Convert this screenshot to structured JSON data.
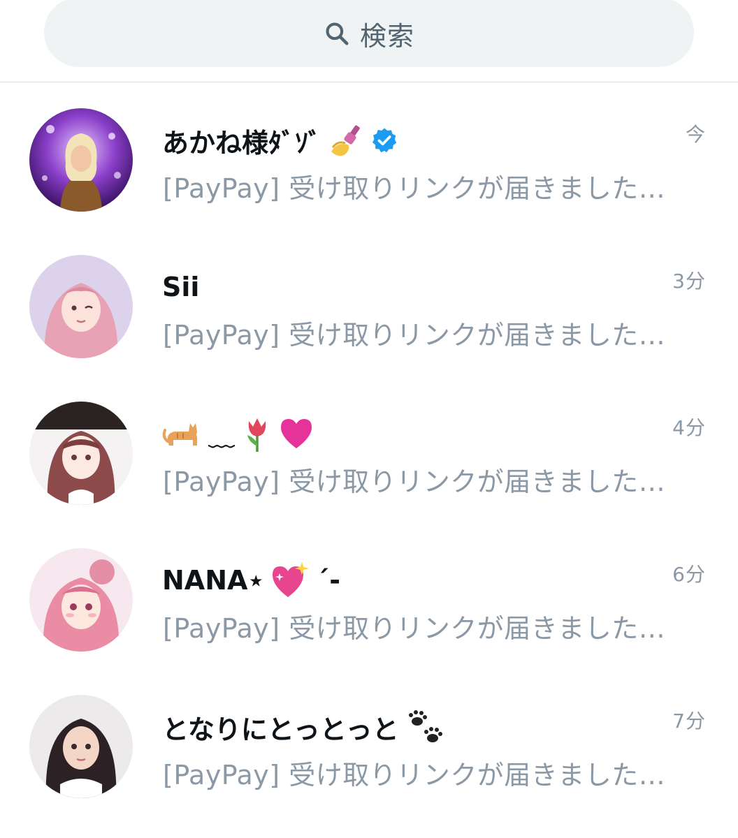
{
  "search": {
    "label": "検索",
    "icon": "search-icon"
  },
  "conversations": [
    {
      "name": "あかね様ﾀﾞｿﾞ",
      "time": "今",
      "preview": "[PayPay] 受け取りリンクが届きました…",
      "icons": [
        "nail-polish-icon",
        "verified-badge-icon"
      ]
    },
    {
      "name": "Sii",
      "time": "3分",
      "preview": "[PayPay] 受け取りリンクが届きました…",
      "icons": []
    },
    {
      "name": "﹏",
      "time": "4分",
      "preview": "[PayPay] 受け取りリンクが届きました…",
      "icons": [
        "cat-icon",
        "tulip-icon",
        "heart-icon"
      ]
    },
    {
      "name": "NANA⋆",
      "suffix": "´-",
      "time": "6分",
      "preview": "[PayPay] 受け取りリンクが届きました…",
      "icons": [
        "sparkling-heart-icon"
      ]
    },
    {
      "name": "となりにとっとっと",
      "time": "7分",
      "preview": "[PayPay] 受け取りリンクが届きました…",
      "icons": [
        "paw-prints-icon"
      ]
    }
  ],
  "colors": {
    "search_bg": "#eff3f4",
    "search_text": "#536471",
    "name_text": "#0f1419",
    "meta_text": "#8b98a5",
    "verified": "#1d9bf0",
    "divider": "#dcdfe3"
  }
}
